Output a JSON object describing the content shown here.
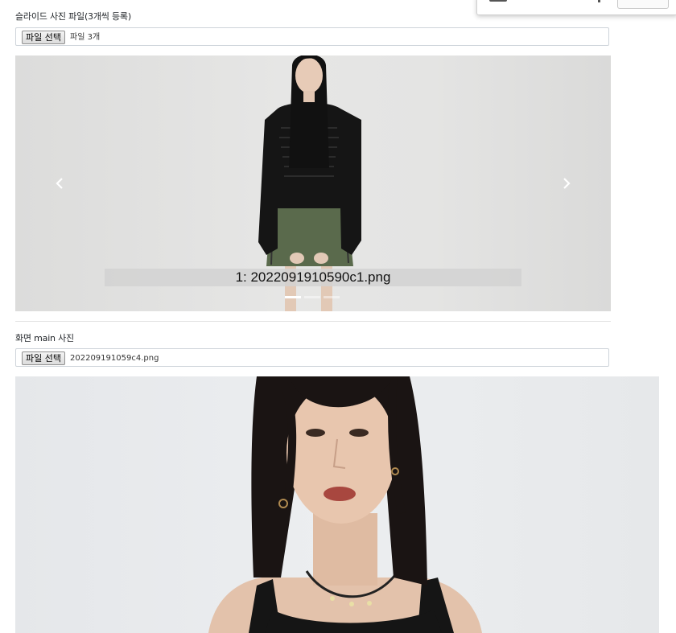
{
  "slide_section": {
    "label": "슬라이드 사진 파일(3개씩 등록)",
    "file_button": "파일 선택",
    "file_status": "파일 3개"
  },
  "carousel": {
    "caption": "1: 2022091910590c1.png",
    "slide_count": 3,
    "active_index": 0,
    "prev_icon": "chevron-left-icon",
    "next_icon": "chevron-right-icon"
  },
  "main_section": {
    "label": "화면 main 사진",
    "file_button": "파일 선택",
    "file_status": "202209191059c4.png"
  },
  "colors": {
    "border": "#ced4da",
    "caption_bg": "#d2d2d2",
    "indicator": "#ffffff"
  }
}
